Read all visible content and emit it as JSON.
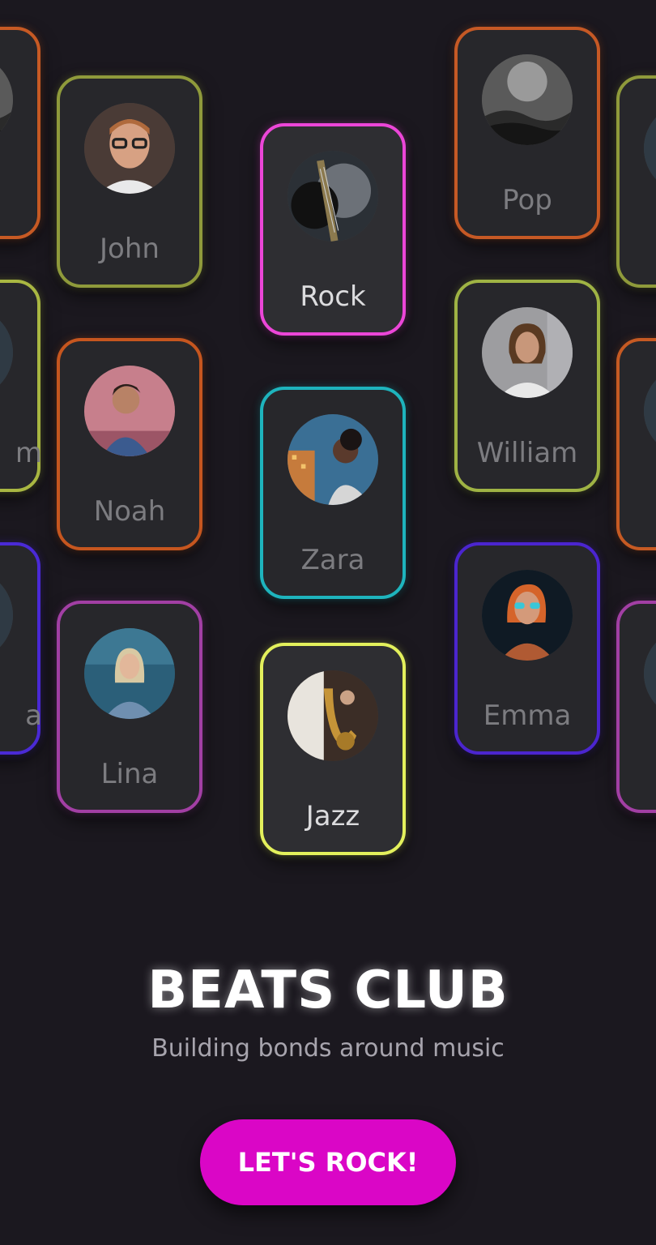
{
  "cards": [
    {
      "id": "partial-tl",
      "label": "",
      "border": "#c75a24",
      "avatar": "crowd-bw-icon"
    },
    {
      "id": "john",
      "label": "John",
      "border": "#8f9a3b",
      "avatar": "man-glasses-icon"
    },
    {
      "id": "rock",
      "label": "Rock",
      "border": "#ec46d8",
      "avatar": "guitar-icon",
      "highlight": true
    },
    {
      "id": "pop",
      "label": "Pop",
      "border": "#c65925",
      "avatar": "crowd-bw-icon"
    },
    {
      "id": "partial-tr",
      "label": "",
      "border": "#8f9a3b",
      "avatar": "person-icon"
    },
    {
      "id": "partial-ml",
      "label": "m",
      "border": "#a9b742",
      "avatar": "person-icon"
    },
    {
      "id": "noah",
      "label": "Noah",
      "border": "#c6561f",
      "avatar": "man-profile-icon"
    },
    {
      "id": "zara",
      "label": "Zara",
      "border": "#1eb4bd",
      "avatar": "woman-city-icon"
    },
    {
      "id": "william",
      "label": "William",
      "border": "#9fb344",
      "avatar": "man-long-hair-icon"
    },
    {
      "id": "partial-mr",
      "label": "",
      "border": "#c65a23",
      "avatar": "person-icon"
    },
    {
      "id": "partial-bl",
      "label": "a",
      "border": "#4a2ad6",
      "avatar": "person-icon"
    },
    {
      "id": "lina",
      "label": "Lina",
      "border": "#a23fa4",
      "avatar": "woman-blonde-icon"
    },
    {
      "id": "jazz",
      "label": "Jazz",
      "border": "#e3f05c",
      "avatar": "saxophone-icon",
      "bright": true
    },
    {
      "id": "emma",
      "label": "Emma",
      "border": "#4b25cf",
      "avatar": "woman-neon-icon"
    },
    {
      "id": "partial-br",
      "label": "",
      "border": "#a23fa4",
      "avatar": "person-icon"
    }
  ],
  "brand": {
    "title": "BEATS CLUB",
    "tagline": "Building bonds around music"
  },
  "cta": {
    "label": "LET'S ROCK!"
  },
  "colors": {
    "background": "#1b181f",
    "accent": "#da06c6"
  }
}
